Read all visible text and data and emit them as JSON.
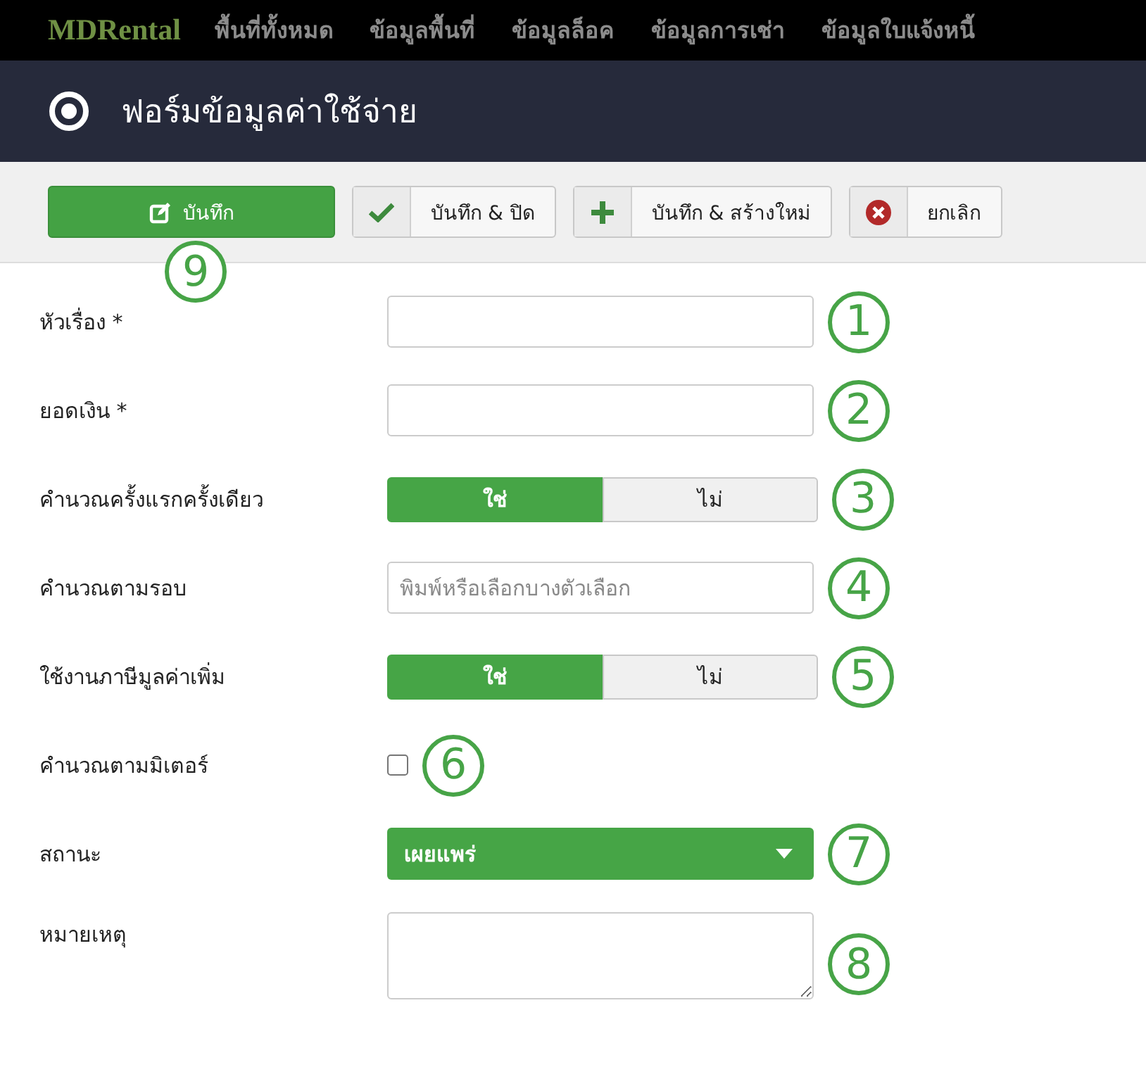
{
  "navbar": {
    "brand": "MDRental",
    "items": [
      "พื้นที่ทั้งหมด",
      "ข้อมูลพื้นที่",
      "ข้อมูลล็อค",
      "ข้อมูลการเช่า",
      "ข้อมูลใบแจ้งหนี้"
    ]
  },
  "header": {
    "title": "ฟอร์มข้อมูลค่าใช้จ่าย"
  },
  "toolbar": [
    {
      "label": "บันทึก",
      "kind": "primary",
      "callout": "9"
    },
    {
      "label": "บันทึก & ปิด",
      "kind": "split"
    },
    {
      "label": "บันทึก & สร้างใหม่",
      "kind": "split"
    },
    {
      "label": "ยกเลิก",
      "kind": "split"
    }
  ],
  "fields": [
    {
      "label": "หัวเรื่อง *",
      "kind": "text",
      "callout": "1"
    },
    {
      "label": "ยอดเงิน *",
      "kind": "text",
      "callout": "2"
    },
    {
      "label": "คำนวณครั้งแรกครั้งเดียว",
      "kind": "toggle",
      "options": [
        {
          "label": "ใช่",
          "selected": true
        },
        {
          "label": "ไม่",
          "selected": false
        }
      ],
      "callout": "3"
    },
    {
      "label": "คำนวณตามรอบ",
      "kind": "text",
      "placeholder": "พิมพ์หรือเลือกบางตัวเลือก",
      "callout": "4"
    },
    {
      "label": "ใช้งานภาษีมูลค่าเพิ่ม",
      "kind": "toggle",
      "options": [
        {
          "label": "ใช่",
          "selected": true
        },
        {
          "label": "ไม่",
          "selected": false
        }
      ],
      "callout": "5"
    },
    {
      "label": "คำนวณตามมิเตอร์",
      "kind": "checkbox",
      "checked": false,
      "callout": "6"
    },
    {
      "label": "สถานะ",
      "kind": "dropdown",
      "value": "เผยแพร่",
      "callout": "7"
    },
    {
      "label": "หมายเหตุ",
      "kind": "textarea",
      "callout": "8"
    }
  ]
}
